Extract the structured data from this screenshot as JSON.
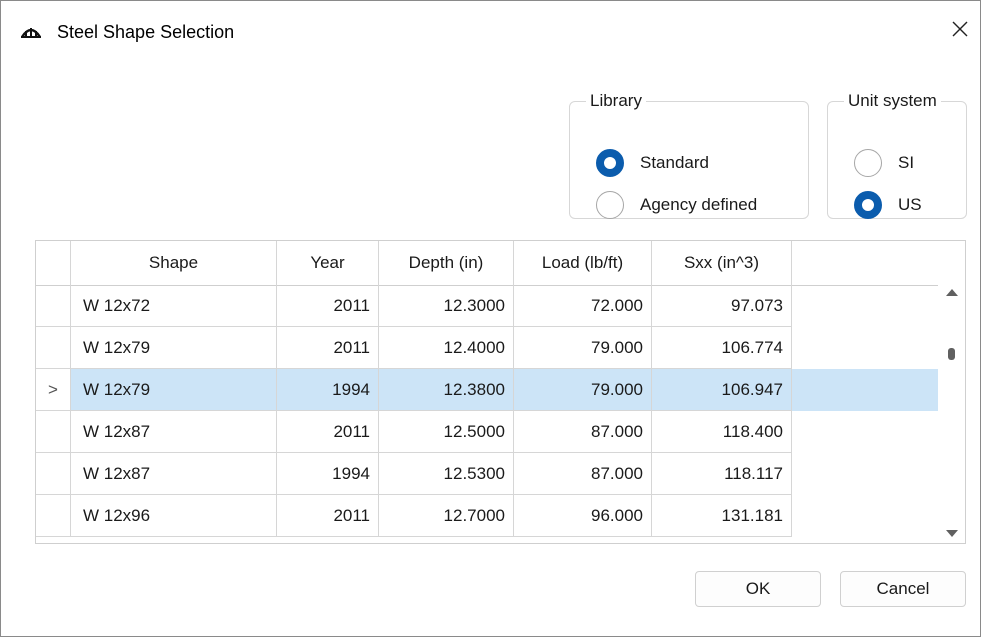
{
  "window": {
    "title": "Steel Shape Selection",
    "app_icon": "bridge-icon",
    "close_icon": "close-icon"
  },
  "library": {
    "legend": "Library",
    "options": [
      {
        "label": "Standard",
        "checked": true
      },
      {
        "label": "Agency defined",
        "checked": false
      }
    ]
  },
  "unit_system": {
    "legend": "Unit system",
    "options": [
      {
        "label": "SI",
        "checked": false
      },
      {
        "label": "US",
        "checked": true
      }
    ]
  },
  "table": {
    "columns": [
      "Shape",
      "Year",
      "Depth (in)",
      "Load (lb/ft)",
      "Sxx (in^3)"
    ],
    "selected_indicator": ">",
    "rows": [
      {
        "shape": "W 12x72",
        "year": "2011",
        "depth": "12.3000",
        "load": "72.000",
        "sxx": "97.073",
        "selected": false
      },
      {
        "shape": "W 12x79",
        "year": "2011",
        "depth": "12.4000",
        "load": "79.000",
        "sxx": "106.774",
        "selected": false
      },
      {
        "shape": "W 12x79",
        "year": "1994",
        "depth": "12.3800",
        "load": "79.000",
        "sxx": "106.947",
        "selected": true
      },
      {
        "shape": "W 12x87",
        "year": "2011",
        "depth": "12.5000",
        "load": "87.000",
        "sxx": "118.400",
        "selected": false
      },
      {
        "shape": "W 12x87",
        "year": "1994",
        "depth": "12.5300",
        "load": "87.000",
        "sxx": "118.117",
        "selected": false
      },
      {
        "shape": "W 12x96",
        "year": "2011",
        "depth": "12.7000",
        "load": "96.000",
        "sxx": "131.181",
        "selected": false
      }
    ]
  },
  "buttons": {
    "ok": "OK",
    "cancel": "Cancel"
  },
  "colors": {
    "accent": "#0b5cad",
    "selection": "#cce4f7"
  }
}
